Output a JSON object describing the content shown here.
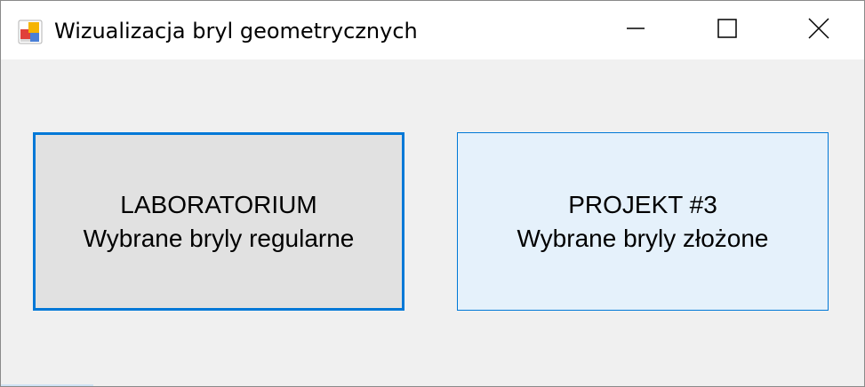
{
  "window": {
    "title": "Wizualizacja bryl geometrycznych",
    "icon": "winforms-app-icon"
  },
  "caption_buttons": {
    "minimize_icon": "minimize-icon",
    "maximize_icon": "maximize-icon",
    "close_icon": "close-icon"
  },
  "buttons": {
    "laboratorium": {
      "line1": "LABORATORIUM",
      "line2": "Wybrane bryly regularne"
    },
    "projekt": {
      "line1": "PROJEKT #3",
      "line2": "Wybrane bryly złożone"
    }
  },
  "colors": {
    "accent": "#0078d7",
    "button_face": "#e1e1e1",
    "button_hover": "#e5f1fb",
    "client_background": "#f0f0f0"
  }
}
